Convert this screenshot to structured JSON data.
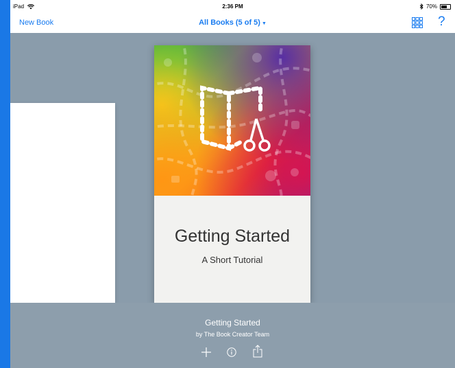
{
  "status": {
    "device": "iPad",
    "time": "2:36 PM",
    "battery_percent": "70%",
    "battery_level": 0.7
  },
  "nav": {
    "new_book": "New Book",
    "title": "All Books (5 of 5)",
    "help": "?"
  },
  "book": {
    "title": "Getting Started",
    "subtitle": "A Short Tutorial"
  },
  "details": {
    "title": "Getting Started",
    "author": "by The Book Creator Team"
  },
  "colors": {
    "accent": "#1a7cf0",
    "background": "#8a9cab"
  },
  "icons": [
    "wifi-icon",
    "bluetooth-icon",
    "battery-icon",
    "grid-view-icon",
    "help-icon",
    "book-creator-logo-icon",
    "plus-icon",
    "info-icon",
    "share-icon"
  ]
}
